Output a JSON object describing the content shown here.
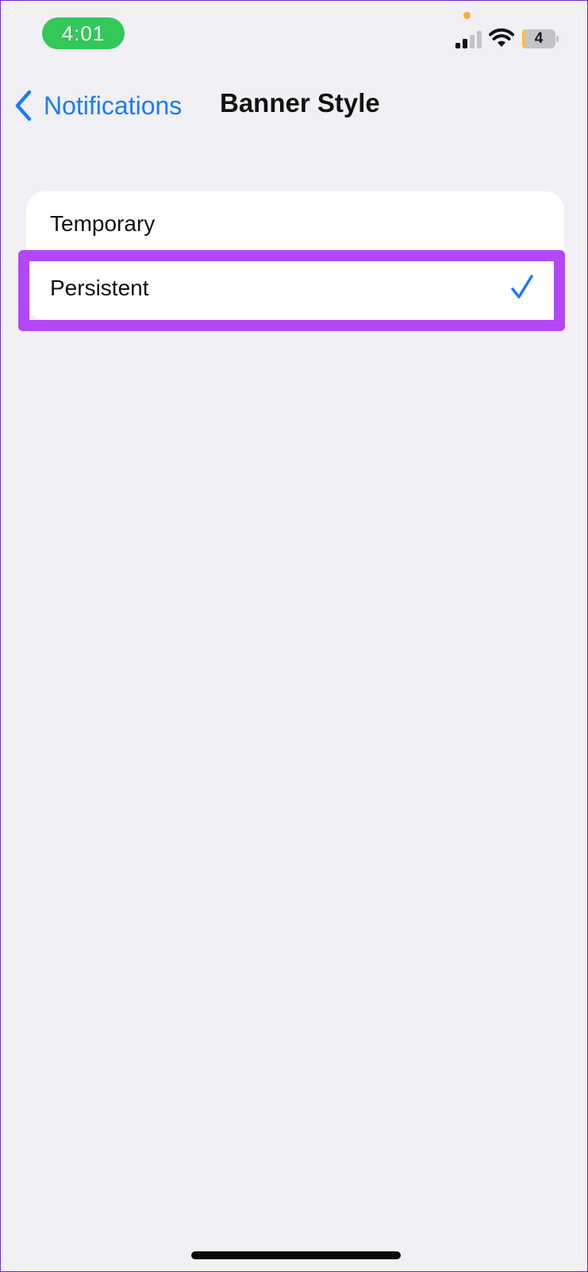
{
  "status_bar": {
    "time": "4:01",
    "battery_level": "4",
    "icons": [
      "signal-icon",
      "wifi-icon",
      "battery-icon"
    ],
    "time_pill_color": "#34c759",
    "privacy_dot_color": "#f7a93b"
  },
  "nav": {
    "back_label": "Notifications",
    "title": "Banner Style",
    "accent_color": "#1a7cf5"
  },
  "options": [
    {
      "label": "Temporary",
      "selected": false
    },
    {
      "label": "Persistent",
      "selected": true
    }
  ],
  "highlight_color": "#b147f5"
}
